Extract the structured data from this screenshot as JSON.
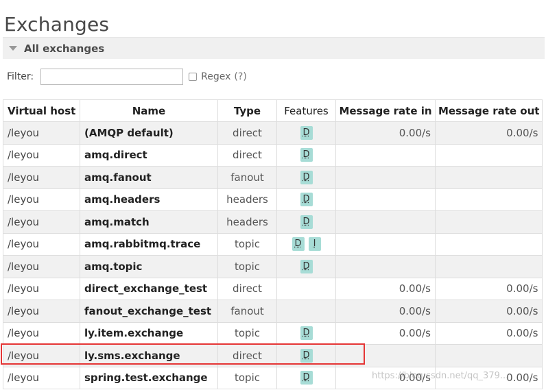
{
  "page": {
    "title": "Exchanges"
  },
  "section": {
    "title": "All exchanges"
  },
  "filter": {
    "label": "Filter:",
    "value": "",
    "regex_label": "Regex",
    "regex_help": "(?)"
  },
  "table": {
    "headers": {
      "vhost": "Virtual host",
      "name": "Name",
      "type": "Type",
      "features": "Features",
      "rate_in": "Message rate in",
      "rate_out": "Message rate out"
    },
    "rows": [
      {
        "vhost": "/leyou",
        "name": "(AMQP default)",
        "type": "direct",
        "features": [
          "D"
        ],
        "rate_in": "0.00/s",
        "rate_out": "0.00/s"
      },
      {
        "vhost": "/leyou",
        "name": "amq.direct",
        "type": "direct",
        "features": [
          "D"
        ],
        "rate_in": "",
        "rate_out": ""
      },
      {
        "vhost": "/leyou",
        "name": "amq.fanout",
        "type": "fanout",
        "features": [
          "D"
        ],
        "rate_in": "",
        "rate_out": ""
      },
      {
        "vhost": "/leyou",
        "name": "amq.headers",
        "type": "headers",
        "features": [
          "D"
        ],
        "rate_in": "",
        "rate_out": ""
      },
      {
        "vhost": "/leyou",
        "name": "amq.match",
        "type": "headers",
        "features": [
          "D"
        ],
        "rate_in": "",
        "rate_out": ""
      },
      {
        "vhost": "/leyou",
        "name": "amq.rabbitmq.trace",
        "type": "topic",
        "features": [
          "D",
          "I"
        ],
        "rate_in": "",
        "rate_out": ""
      },
      {
        "vhost": "/leyou",
        "name": "amq.topic",
        "type": "topic",
        "features": [
          "D"
        ],
        "rate_in": "",
        "rate_out": ""
      },
      {
        "vhost": "/leyou",
        "name": "direct_exchange_test",
        "type": "direct",
        "features": [],
        "rate_in": "0.00/s",
        "rate_out": "0.00/s"
      },
      {
        "vhost": "/leyou",
        "name": "fanout_exchange_test",
        "type": "fanout",
        "features": [],
        "rate_in": "0.00/s",
        "rate_out": "0.00/s"
      },
      {
        "vhost": "/leyou",
        "name": "ly.item.exchange",
        "type": "topic",
        "features": [
          "D"
        ],
        "rate_in": "0.00/s",
        "rate_out": "0.00/s"
      },
      {
        "vhost": "/leyou",
        "name": "ly.sms.exchange",
        "type": "direct",
        "features": [
          "D"
        ],
        "rate_in": "",
        "rate_out": ""
      },
      {
        "vhost": "/leyou",
        "name": "spring.test.exchange",
        "type": "topic",
        "features": [
          "D"
        ],
        "rate_in": "0.00/s",
        "rate_out": "0.00/s"
      }
    ]
  },
  "watermark": "https://blog.csdn.net/qq_379..."
}
